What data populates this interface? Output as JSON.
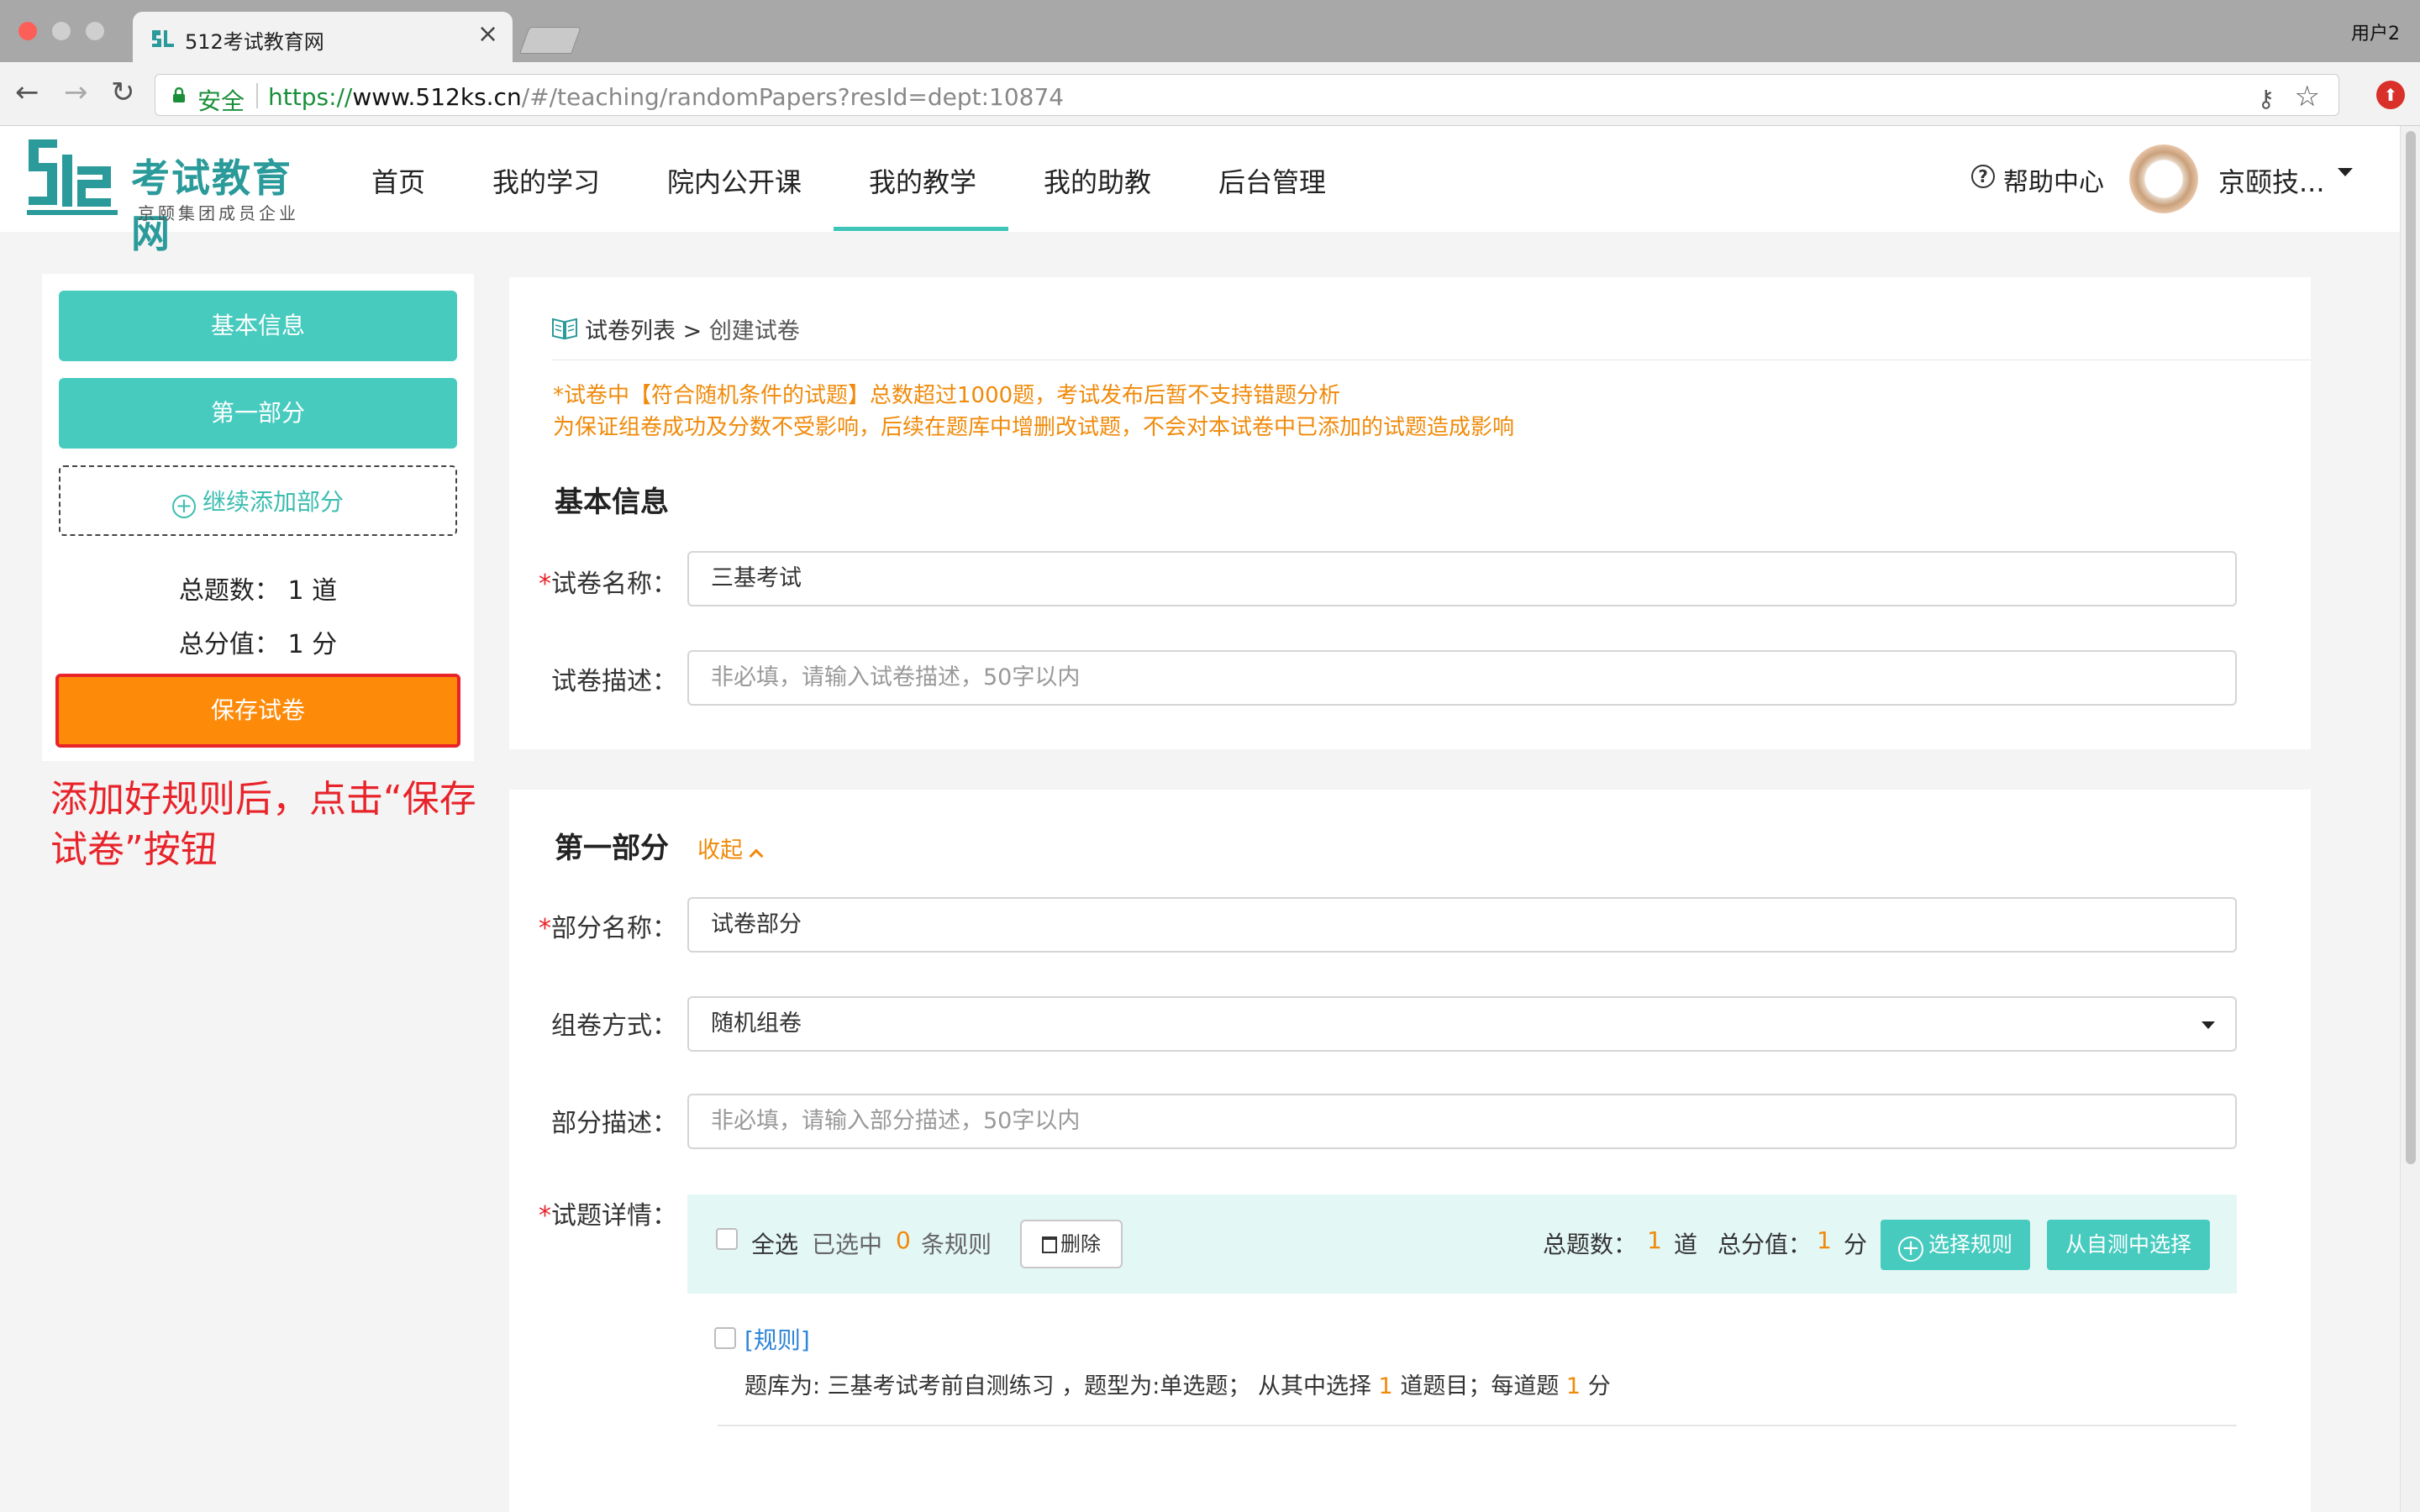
{
  "browser": {
    "tab_title": "512考试教育网",
    "tab_close": "×",
    "profile_name": "用户2",
    "secure_label": "安全",
    "url_scheme": "https://",
    "url_domain": "www.512ks.cn",
    "url_path": "/#/teaching/randomPapers?resId=dept:10874",
    "back_glyph": "←",
    "forward_glyph": "→",
    "reload_glyph": "↻",
    "key_glyph": "⚷",
    "star_glyph": "☆",
    "ext_glyph": "⬆"
  },
  "site": {
    "logo_title": "考试教育网",
    "logo_subtitle": "京颐集团成员企业",
    "nav": [
      "首页",
      "我的学习",
      "院内公开课",
      "我的教学",
      "我的助教",
      "后台管理"
    ],
    "active_nav": "我的教学",
    "help_label": "帮助中心",
    "help_glyph": "?",
    "user_name": "京颐技..."
  },
  "left_panel": {
    "basic_info": "基本信息",
    "part1": "第一部分",
    "add_part": "继续添加部分",
    "add_part_glyph": "+",
    "total_questions": "总题数：  1 道",
    "total_score": "总分值：  1 分",
    "save": "保存试卷"
  },
  "tip": "添加好规则后，点击“保存试卷”按钮",
  "main": {
    "breadcrumb_root": "试卷列表",
    "breadcrumb_sep": ">",
    "breadcrumb_current": "创建试卷",
    "warning1": "*试卷中【符合随机条件的试题】总数超过1000题，考试发布后暂不支持错题分析",
    "warning2": "为保证组卷成功及分数不受影响，后续在题库中增删改试题，不会对本试卷中已添加的试题造成影响",
    "basic_title": "基本信息",
    "required_mark": "*",
    "paper_name_label": "试卷名称：",
    "paper_name_value": "三基考试",
    "paper_desc_label": "试卷描述：",
    "paper_desc_placeholder": "非必填，请输入试卷描述，50字以内",
    "part_title": "第一部分",
    "fold": "收起",
    "part_name_label": "部分名称：",
    "part_name_value": "试卷部分",
    "compose_label": "组卷方式：",
    "compose_value": "随机组卷",
    "part_desc_label": "部分描述：",
    "part_desc_placeholder": "非必填，请输入部分描述，50字以内",
    "detail_label": "试题详情：",
    "select_all": "全选",
    "selected_prefix": "已选中",
    "selected_count": "0",
    "selected_suffix": "条规则",
    "delete": "删除",
    "total_q_label": "总题数：",
    "total_q": "1",
    "total_q_unit": "道",
    "total_s_label": "总分值：",
    "total_s": "1",
    "total_s_unit": "分",
    "choose_rule": "选择规则",
    "choose_rule_glyph": "+",
    "from_selftest": "从自测中选择",
    "rule_link": "[规则]",
    "rule_desc_a": "题库为: 三基考试考前自测练习 ，题型为:单选题；  从其中选择",
    "rule_desc_n1": "1",
    "rule_desc_b": "道题目；每道题",
    "rule_desc_n2": "1",
    "rule_desc_c": "分"
  },
  "colors": {
    "teal": "#48cbbf",
    "orange": "#fe8a09",
    "red": "#e8232a",
    "warning": "#f08a0a",
    "link": "#2f85d8"
  }
}
